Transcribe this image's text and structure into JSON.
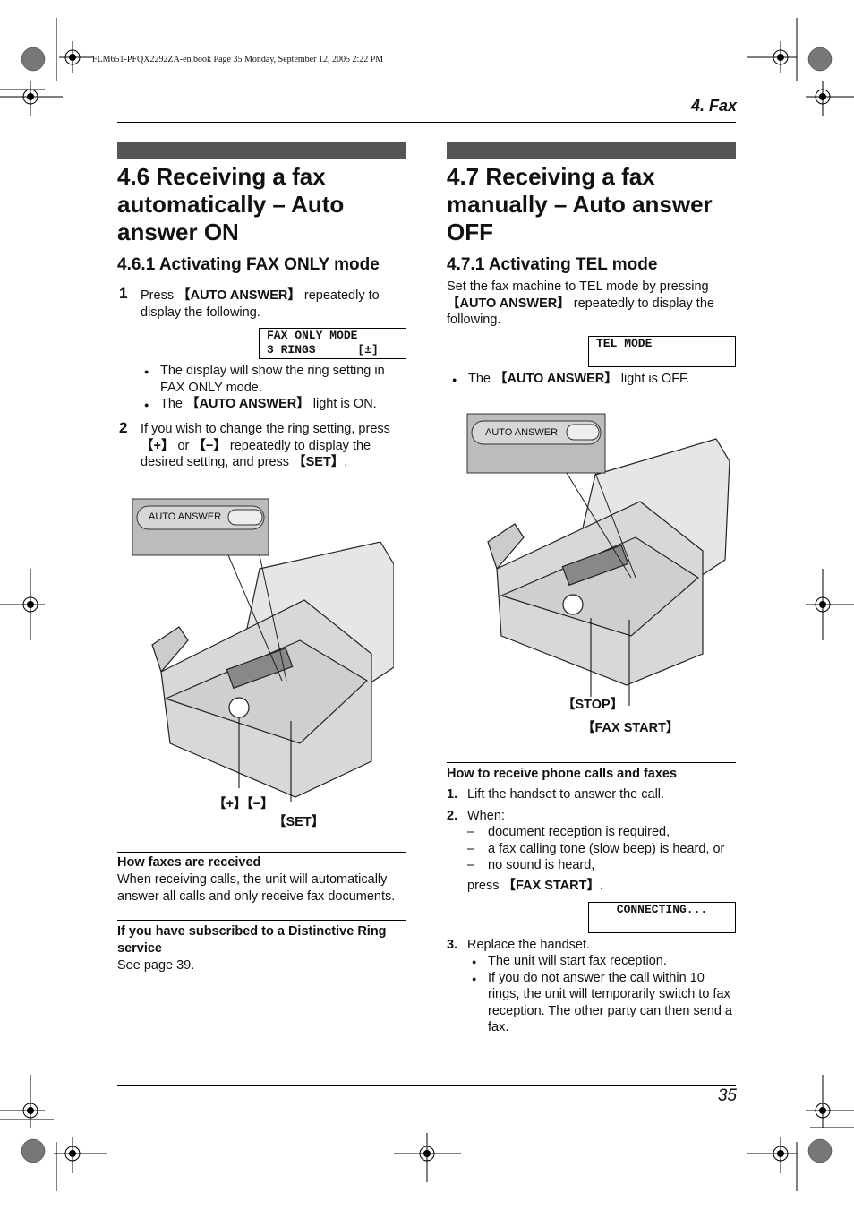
{
  "book_line": "FLM651-PFQX2292ZA-en.book  Page 35  Monday, September 12, 2005  2:22 PM",
  "header": {
    "chapter": "4. Fax"
  },
  "footer": {
    "page_number": "35"
  },
  "left": {
    "title": "4.6 Receiving a fax automatically – Auto answer ON",
    "subtitle": "4.6.1 Activating FAX ONLY mode",
    "step1": {
      "num": "1",
      "pre": "Press ",
      "key": "【AUTO ANSWER】",
      "post": " repeatedly to display the following."
    },
    "lcd": "FAX ONLY MODE\n3 RINGS      [±]",
    "bullets": [
      {
        "text": "The display will show the ring setting in FAX ONLY mode."
      },
      {
        "pre": "The ",
        "key": "【AUTO ANSWER】",
        "post": " light is ON."
      }
    ],
    "step2": {
      "num": "2",
      "t1": "If you wish to change the ring setting, press ",
      "k1": "【+】",
      "t2": " or ",
      "k2": "【−】",
      "t3": " repeatedly to display the desired setting, and press ",
      "k3": "【SET】",
      "t4": "."
    },
    "figure": {
      "panel_label": "AUTO ANSWER",
      "callout_plusminus": "【+】【−】",
      "callout_set": "【SET】"
    },
    "how_received": {
      "heading": "How faxes are received",
      "body": "When receiving calls, the unit will automatically answer all calls and only receive fax documents."
    },
    "distinctive": {
      "heading": "If you have subscribed to a Distinctive Ring service",
      "body": "See page 39."
    }
  },
  "right": {
    "title": "4.7 Receiving a fax manually – Auto answer OFF",
    "subtitle": "4.7.1 Activating TEL mode",
    "intro": {
      "pre": "Set the fax machine to TEL mode by pressing ",
      "key": "【AUTO ANSWER】",
      "post": " repeatedly to display the following."
    },
    "lcd": "TEL MODE",
    "bullet": {
      "pre": "The ",
      "key": "【AUTO ANSWER】",
      "post": " light is OFF."
    },
    "figure": {
      "panel_label": "AUTO ANSWER",
      "callout_stop": "【STOP】",
      "callout_faxstart": "【FAX START】"
    },
    "howto": {
      "heading": "How to receive phone calls and faxes",
      "step1": {
        "num": "1.",
        "text": "Lift the handset to answer the call."
      },
      "step2": {
        "num": "2.",
        "text": "When:",
        "dashes": [
          "document reception is required,",
          "a fax calling tone (slow beep) is heard, or",
          "no sound is heard,"
        ],
        "press_pre": "press ",
        "press_key": "【FAX START】",
        "press_post": "."
      },
      "lcd": "CONNECTING...",
      "step3": {
        "num": "3.",
        "text": "Replace the handset.",
        "bullets": [
          "The unit will start fax reception.",
          "If you do not answer the call within 10 rings, the unit will temporarily switch to fax reception. The other party can then send a fax."
        ]
      }
    }
  }
}
